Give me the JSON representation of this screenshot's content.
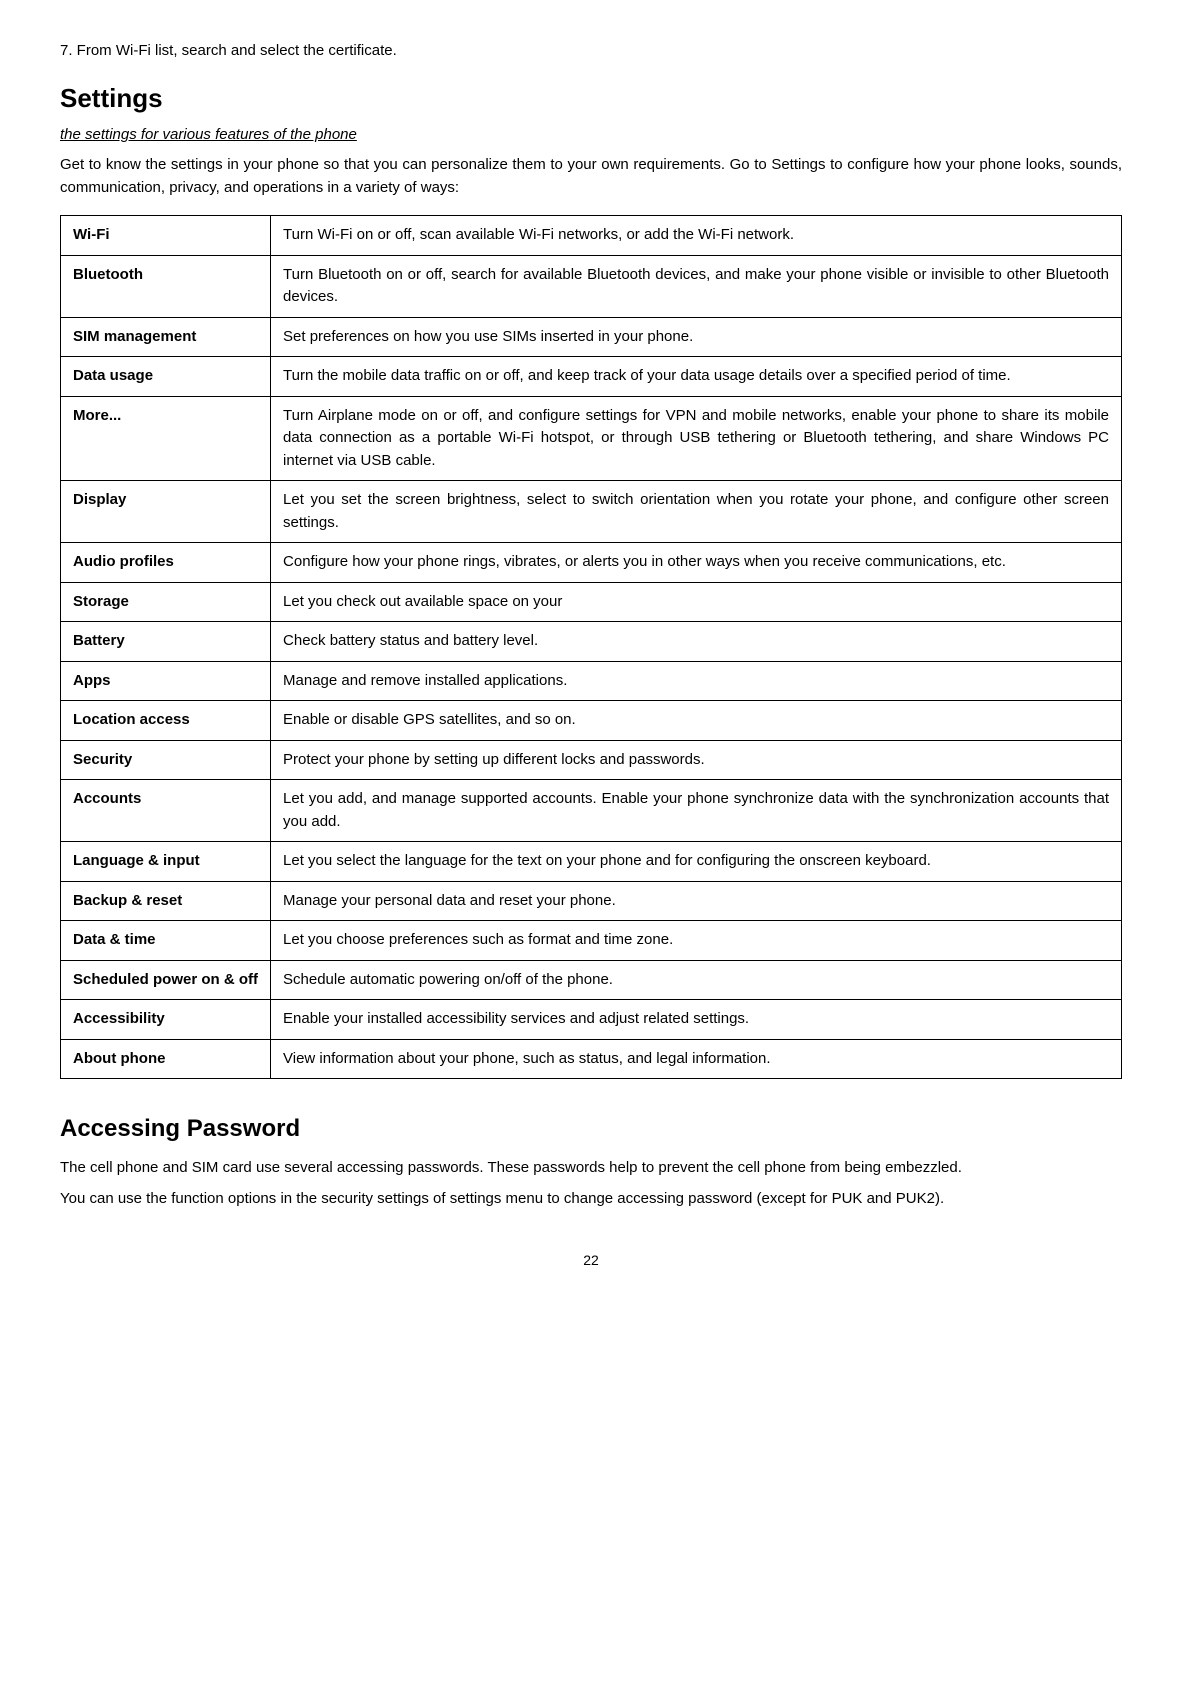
{
  "intro": {
    "step7": "7. From Wi-Fi list, search and select the certificate."
  },
  "settings_section": {
    "title": "Settings",
    "subtitle": "the settings for various features of the phone",
    "description": "Get to know the settings in your phone so that you can personalize them to your own requirements. Go to Settings to configure how your phone looks, sounds, communication, privacy, and operations in a variety of ways:"
  },
  "table_rows": [
    {
      "label": "Wi-Fi",
      "description": "Turn Wi-Fi on or off, scan available Wi-Fi networks, or add the Wi-Fi network."
    },
    {
      "label": "Bluetooth",
      "description": "Turn Bluetooth on or off, search for available Bluetooth devices, and make your phone visible or invisible to other Bluetooth devices."
    },
    {
      "label": "SIM management",
      "description": "Set preferences on how you use SIMs inserted in your phone."
    },
    {
      "label": "Data usage",
      "description": "Turn the mobile data traffic on or off, and keep track of your data usage details over a specified period of time."
    },
    {
      "label": "More...",
      "description": "Turn Airplane mode on or off, and configure settings for VPN and mobile networks, enable your phone to share its mobile data connection as a portable Wi-Fi hotspot, or through USB tethering or Bluetooth tethering, and share Windows PC internet via USB cable."
    },
    {
      "label": "Display",
      "description": "Let you set the screen brightness, select to switch orientation when you rotate your phone, and configure other screen settings."
    },
    {
      "label": "Audio profiles",
      "description": "Configure how your phone rings, vibrates, or alerts you in other ways when you receive communications, etc."
    },
    {
      "label": "Storage",
      "description": "Let you check out available space on your"
    },
    {
      "label": "Battery",
      "description": "Check battery status and battery level."
    },
    {
      "label": "Apps",
      "description": "Manage and remove installed applications."
    },
    {
      "label": "Location access",
      "description": "Enable or disable GPS satellites, and so on."
    },
    {
      "label": "Security",
      "description": "Protect your phone by setting up different locks and passwords."
    },
    {
      "label": "Accounts",
      "description": "Let you add, and manage supported accounts. Enable your phone synchronize data with the synchronization accounts that you add."
    },
    {
      "label": "Language & input",
      "description": "Let you select the language for the text on your phone and for configuring the onscreen keyboard."
    },
    {
      "label": "Backup & reset",
      "description": "Manage your personal data and reset your phone."
    },
    {
      "label": "Data & time",
      "description": "Let you choose preferences such as format and time zone."
    },
    {
      "label": "Scheduled power on & off",
      "description": "Schedule automatic powering on/off of the phone."
    },
    {
      "label": "Accessibility",
      "description": "Enable your installed accessibility services and adjust related settings."
    },
    {
      "label": "About phone",
      "description": "View information about your phone, such as status, and legal information."
    }
  ],
  "accessing_section": {
    "title": "Accessing Password",
    "para1": "The cell phone and SIM card use several accessing passwords. These passwords help to prevent the cell phone from being embezzled.",
    "para2": "You can use the function options in the security settings of settings menu to change accessing password (except for PUK and PUK2)."
  },
  "page_number": "22"
}
